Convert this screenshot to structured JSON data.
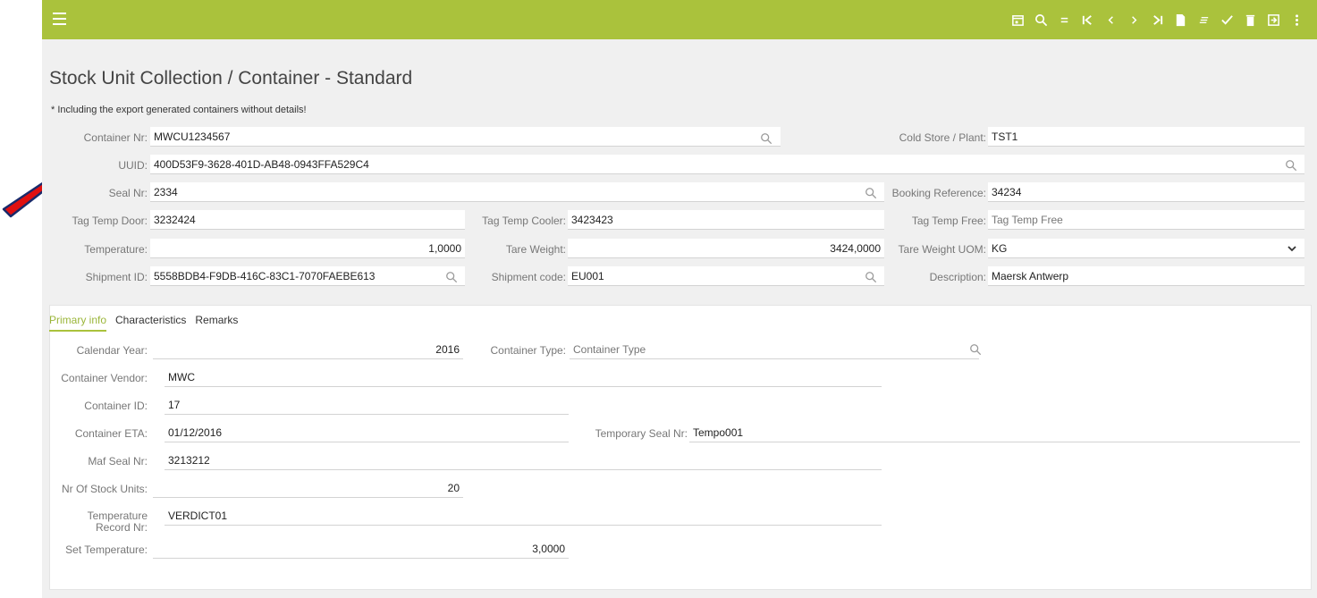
{
  "toolbar": {
    "menu_icon": "hamburger-icon",
    "icons": [
      "calendar-icon",
      "search-icon",
      "equals-icon",
      "first-record-icon",
      "previous-icon",
      "next-icon",
      "last-record-icon",
      "new-document-icon",
      "filter-icon",
      "check-icon",
      "delete-icon",
      "exit-icon",
      "more-vertical-icon"
    ],
    "accent_color": "#aac23c"
  },
  "page": {
    "title": "Stock Unit Collection / Container - Standard",
    "note": "* Including the export generated containers without details!"
  },
  "header_fields": {
    "container_nr": {
      "label": "Container Nr:",
      "value": "MWCU1234567"
    },
    "cold_store": {
      "label": "Cold Store / Plant:",
      "value": "TST1"
    },
    "uuid": {
      "label": "UUID:",
      "value": "400D53F9-3628-401D-AB48-0943FFA529C4"
    },
    "seal_nr": {
      "label": "Seal Nr:",
      "value": "2334"
    },
    "booking_reference": {
      "label": "Booking Reference:",
      "value": "34234"
    },
    "tag_temp_door": {
      "label": "Tag Temp Door:",
      "value": "3232424"
    },
    "tag_temp_cooler": {
      "label": "Tag Temp Cooler:",
      "value": "3423423"
    },
    "tag_temp_free": {
      "label": "Tag Temp Free:",
      "placeholder": "Tag Temp Free"
    },
    "temperature": {
      "label": "Temperature:",
      "value": "1,0000"
    },
    "tare_weight": {
      "label": "Tare Weight:",
      "value": "3424,0000"
    },
    "tare_weight_uom": {
      "label": "Tare Weight UOM:",
      "value": "KG"
    },
    "shipment_id": {
      "label": "Shipment ID:",
      "value": "5558BDB4-F9DB-416C-83C1-7070FAEBE613"
    },
    "shipment_code": {
      "label": "Shipment code:",
      "value": "EU001"
    },
    "description": {
      "label": "Description:",
      "value": "Maersk Antwerp"
    }
  },
  "tabs": [
    {
      "label": "Primary info",
      "active": true
    },
    {
      "label": "Characteristics",
      "active": false
    },
    {
      "label": "Remarks",
      "active": false
    }
  ],
  "primary_info": {
    "calendar_year": {
      "label": "Calendar Year:",
      "value": "2016"
    },
    "container_type": {
      "label": "Container Type:",
      "placeholder": "Container Type"
    },
    "container_vendor": {
      "label": "Container Vendor:",
      "value": "MWC"
    },
    "container_id": {
      "label": "Container ID:",
      "value": "17"
    },
    "container_eta": {
      "label": "Container ETA:",
      "value": "01/12/2016"
    },
    "temporary_seal_nr": {
      "label": "Temporary Seal Nr:",
      "value": "Tempo001"
    },
    "maf_seal_nr": {
      "label": "Maf Seal Nr:",
      "value": "3213212"
    },
    "nr_of_stock_units": {
      "label": "Nr Of Stock Units:",
      "value": "20"
    },
    "temperature_record_nr": {
      "label_line1": "Temperature",
      "label_line2": "Record Nr:",
      "value": "VERDICT01"
    },
    "set_temperature": {
      "label": "Set Temperature:",
      "value": "3,0000"
    }
  },
  "annotation": {
    "arrow_color": "#e01010",
    "arrow_icon": "red-arrow-icon"
  }
}
